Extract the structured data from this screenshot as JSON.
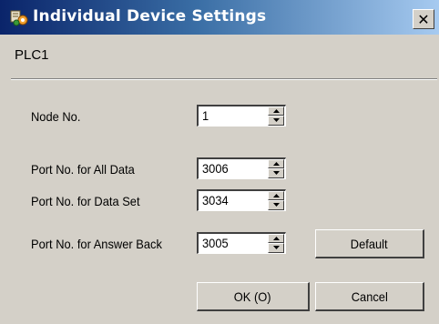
{
  "window": {
    "title": "Individual Device Settings",
    "close_glyph": "✕",
    "title_icon": "settings-gear-icon"
  },
  "header": {
    "plc_name": "PLC1"
  },
  "fields": {
    "node_no": {
      "label": "Node No.",
      "value": "1"
    },
    "port_all_data": {
      "label": "Port No. for All Data",
      "value": "3006"
    },
    "port_data_set": {
      "label": "Port No. for Data Set",
      "value": "3034"
    },
    "port_answer_back": {
      "label": "Port No. for Answer Back",
      "value": "3005"
    }
  },
  "buttons": {
    "default_label": "Default",
    "ok_label": "OK (O)",
    "cancel_label": "Cancel"
  },
  "colors": {
    "titlebar_start": "#0a246a",
    "titlebar_end": "#a6caf0",
    "dialog_face": "#d4d0c8"
  }
}
